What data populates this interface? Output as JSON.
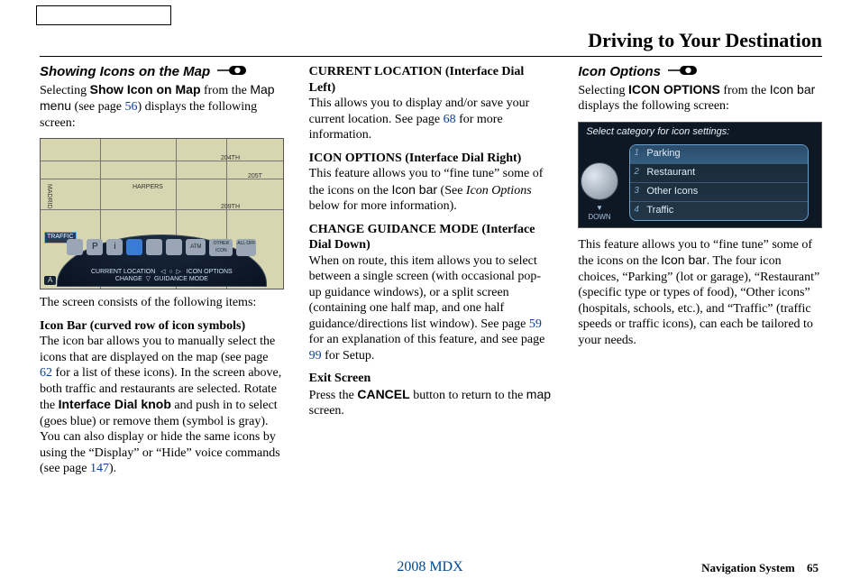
{
  "header": {
    "title": "Driving to Your Destination"
  },
  "col1": {
    "section_title": "Showing Icons on the Map",
    "p1_a": "Selecting ",
    "p1_b": "Show Icon on Map",
    "p1_c": " from the ",
    "p1_d": "Map menu",
    "p1_e": " (see page ",
    "p1_ref": "56",
    "p1_f": ") displays the following screen:",
    "map": {
      "traffic": "TRAFFIC",
      "dock_icons": [
        "",
        "P",
        "i",
        "",
        "",
        "",
        "ATM",
        "OTHER ICON",
        "ALL OFF"
      ],
      "dock_lbl_current": "CURRENT LOCATION",
      "dock_lbl_iconopt": "ICON OPTIONS",
      "dock_lbl_change": "CHANGE",
      "dock_lbl_guidance": "GUIDANCE MODE",
      "scale": "A",
      "rd1": "204TH",
      "rd2": "205T",
      "rd3": "209TH",
      "rd4": "HARPERS",
      "rd5": "MADRID"
    },
    "p2": "The screen consists of the following items:",
    "sub1": "Icon Bar (curved row of icon symbols)",
    "p3_a": "The icon bar allows you to manually select the icons that are displayed on the map (see page ",
    "p3_ref": "62",
    "p3_b": " for a list of these icons). In the screen above, both traffic and restaurants are selected. Rotate the ",
    "p3_c": "Interface Dial knob",
    "p3_d": " and push in to select (goes blue) or remove them (symbol is gray). You can also display or hide the same icons by using the “Display” or “Hide” voice commands (see page ",
    "p3_ref2": "147",
    "p3_e": ")."
  },
  "col2": {
    "sub1": "CURRENT LOCATION (Interface Dial Left)",
    "p1_a": "This allows you to display and/or save your current location. See page ",
    "p1_ref": "68",
    "p1_b": " for more information.",
    "sub2": "ICON OPTIONS (Interface Dial Right)",
    "p2_a": "This feature allows you to “fine tune” some of the icons on the ",
    "p2_b": "Icon bar",
    "p2_c": " (See ",
    "p2_d": "Icon Options",
    "p2_e": " below for more information).",
    "sub3": "CHANGE GUIDANCE MODE (Interface Dial Down)",
    "p3_a": "When on route, this item allows you to select between a single screen (with occasional pop-up guidance windows), or a split screen (containing one half map, and one half guidance/directions list window). See page ",
    "p3_ref1": "59",
    "p3_b": " for an explanation of this feature, and see page ",
    "p3_ref2": "99",
    "p3_c": " for Setup.",
    "sub4": "Exit Screen",
    "p4_a": "Press the ",
    "p4_b": "CANCEL",
    "p4_c": " button to return to the ",
    "p4_d": "map",
    "p4_e": " screen."
  },
  "col3": {
    "section_title": "Icon Options",
    "p1_a": "Selecting ",
    "p1_b": "ICON OPTIONS",
    "p1_c": " from the ",
    "p1_d": "Icon bar",
    "p1_e": " displays the following screen:",
    "screen": {
      "title": "Select category for icon settings:",
      "rows": [
        {
          "n": "1",
          "t": "Parking"
        },
        {
          "n": "2",
          "t": "Restaurant"
        },
        {
          "n": "3",
          "t": "Other Icons"
        },
        {
          "n": "4",
          "t": "Traffic"
        }
      ],
      "down": "DOWN"
    },
    "p2_a": "This feature allows you to “fine tune” some of the icons on the ",
    "p2_b": "Icon bar",
    "p2_c": ". The four icon choices, “Parking” (lot or garage), “Restaurant” (specific type or types of food), “Other icons” (hospitals, schools, etc.), and “Traffic” (traffic speeds or traffic icons), can each be tailored to your needs."
  },
  "footer": {
    "center": "2008  MDX",
    "label": "Navigation System",
    "page": "65"
  }
}
